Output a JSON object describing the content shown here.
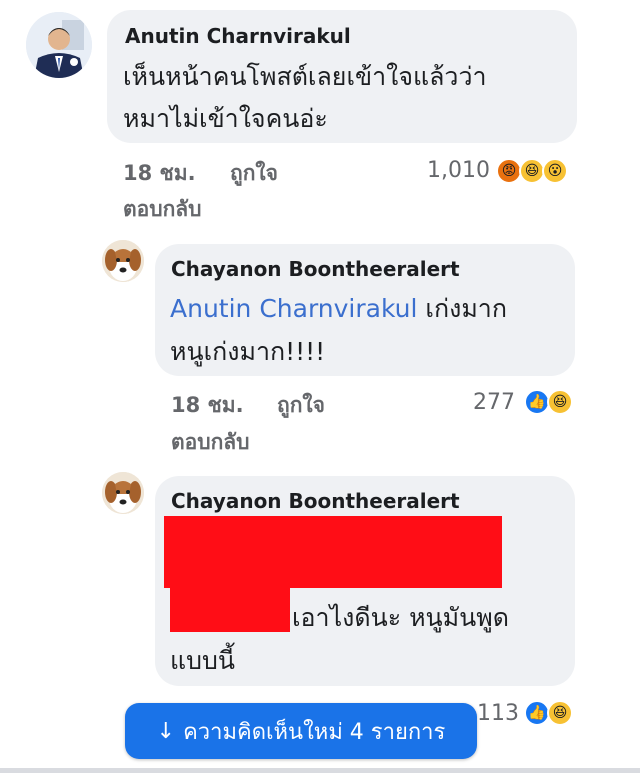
{
  "comments": [
    {
      "author": "Anutin Charnvirakul",
      "text_lines": [
        "เห็นหน้าคนโพสต์เลยเข้าใจแล้วว่า",
        "หมาไม่เข้าใจคนอ่ะ"
      ],
      "time": "18 ชม.",
      "like_label": "ถูกใจ",
      "reply_label": "ตอบกลับ",
      "reaction_count": "1,010",
      "reactions": [
        "angry-icon",
        "haha-icon",
        "wow-icon"
      ]
    },
    {
      "author": "Chayanon Boontheeralert",
      "mention": "Anutin Charnvirakul",
      "line1_rest": " เก่งมาก",
      "line2": "หนูเก่งมาก!!!!",
      "time": "18 ชม.",
      "like_label": "ถูกใจ",
      "reply_label": "ตอบกลับ",
      "reaction_count": "277",
      "reactions": [
        "like-icon",
        "haha-icon"
      ]
    },
    {
      "author": "Chayanon Boontheeralert",
      "line2_visible": "เอาไงดีนะ หนูมันพูด",
      "line3": "แบบนี้",
      "reaction_count": "113",
      "reactions": [
        "like-icon",
        "haha-icon"
      ]
    }
  ],
  "new_comments_button": {
    "arrow": "↓",
    "label": "ความคิดเห็นใหม่ 4 รายการ"
  },
  "colors": {
    "bubble": "#eff1f4",
    "mention": "#3b6fce",
    "button": "#1a73e8",
    "redaction": "#ff0d16"
  }
}
